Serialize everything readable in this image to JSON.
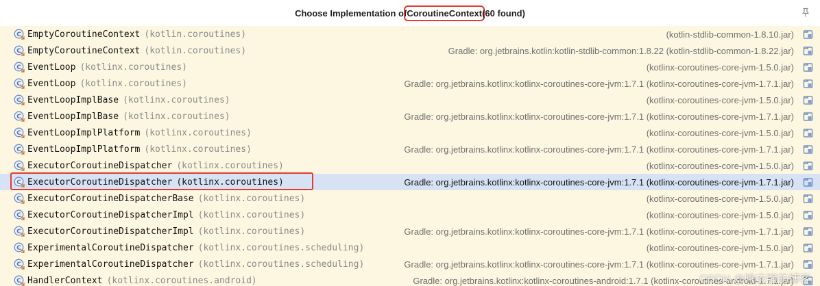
{
  "header": {
    "title_prefix": "Choose Implementation of ",
    "title_symbol": "CoroutineContext",
    "title_suffix": " (60 found)"
  },
  "colors": {
    "highlight_border": "#e53a2c",
    "selected_row": "#d7e3f5",
    "list_background": "#fdf6e0"
  },
  "icons": {
    "header_action": "pin-icon",
    "class_entry": "class-icon",
    "library_entry": "jar-library-icon"
  },
  "rows": [
    {
      "name": "EmptyCoroutineContext",
      "pkg": "(kotlin.coroutines)",
      "lib": "(kotlin-stdlib-common-1.8.10.jar)"
    },
    {
      "name": "EmptyCoroutineContext",
      "pkg": "(kotlin.coroutines)",
      "lib": "Gradle: org.jetbrains.kotlin:kotlin-stdlib-common:1.8.22 (kotlin-stdlib-common-1.8.22.jar)"
    },
    {
      "name": "EventLoop",
      "pkg": "(kotlinx.coroutines)",
      "lib": "(kotlinx-coroutines-core-jvm-1.5.0.jar)"
    },
    {
      "name": "EventLoop",
      "pkg": "(kotlinx.coroutines)",
      "lib": "Gradle: org.jetbrains.kotlinx:kotlinx-coroutines-core-jvm:1.7.1 (kotlinx-coroutines-core-jvm-1.7.1.jar)"
    },
    {
      "name": "EventLoopImplBase",
      "pkg": "(kotlinx.coroutines)",
      "lib": "(kotlinx-coroutines-core-jvm-1.5.0.jar)"
    },
    {
      "name": "EventLoopImplBase",
      "pkg": "(kotlinx.coroutines)",
      "lib": "Gradle: org.jetbrains.kotlinx:kotlinx-coroutines-core-jvm:1.7.1 (kotlinx-coroutines-core-jvm-1.7.1.jar)"
    },
    {
      "name": "EventLoopImplPlatform",
      "pkg": "(kotlinx.coroutines)",
      "lib": "(kotlinx-coroutines-core-jvm-1.5.0.jar)"
    },
    {
      "name": "EventLoopImplPlatform",
      "pkg": "(kotlinx.coroutines)",
      "lib": "Gradle: org.jetbrains.kotlinx:kotlinx-coroutines-core-jvm:1.7.1 (kotlinx-coroutines-core-jvm-1.7.1.jar)"
    },
    {
      "name": "ExecutorCoroutineDispatcher",
      "pkg": "(kotlinx.coroutines)",
      "lib": "(kotlinx-coroutines-core-jvm-1.5.0.jar)"
    },
    {
      "name": "ExecutorCoroutineDispatcher",
      "pkg": "(kotlinx.coroutines)",
      "lib": "Gradle: org.jetbrains.kotlinx:kotlinx-coroutines-core-jvm:1.7.1 (kotlinx-coroutines-core-jvm-1.7.1.jar)",
      "selected": true
    },
    {
      "name": "ExecutorCoroutineDispatcherBase",
      "pkg": "(kotlinx.coroutines)",
      "lib": "(kotlinx-coroutines-core-jvm-1.5.0.jar)"
    },
    {
      "name": "ExecutorCoroutineDispatcherImpl",
      "pkg": "(kotlinx.coroutines)",
      "lib": "(kotlinx-coroutines-core-jvm-1.5.0.jar)"
    },
    {
      "name": "ExecutorCoroutineDispatcherImpl",
      "pkg": "(kotlinx.coroutines)",
      "lib": "Gradle: org.jetbrains.kotlinx:kotlinx-coroutines-core-jvm:1.7.1 (kotlinx-coroutines-core-jvm-1.7.1.jar)"
    },
    {
      "name": "ExperimentalCoroutineDispatcher",
      "pkg": "(kotlinx.coroutines.scheduling)",
      "lib": "(kotlinx-coroutines-core-jvm-1.5.0.jar)"
    },
    {
      "name": "ExperimentalCoroutineDispatcher",
      "pkg": "(kotlinx.coroutines.scheduling)",
      "lib": "Gradle: org.jetbrains.kotlinx:kotlinx-coroutines-core-jvm:1.7.1 (kotlinx-coroutines-core-jvm-1.7.1.jar)"
    },
    {
      "name": "HandlerContext",
      "pkg": "(kotlinx.coroutines.android)",
      "lib": "Gradle: org.jetbrains.kotlinx:kotlinx-coroutines-android:1.7.1 (kotlinx-coroutines-android-1.7.1.jar)"
    }
  ],
  "watermark": "CSDN @喻志强的博客"
}
